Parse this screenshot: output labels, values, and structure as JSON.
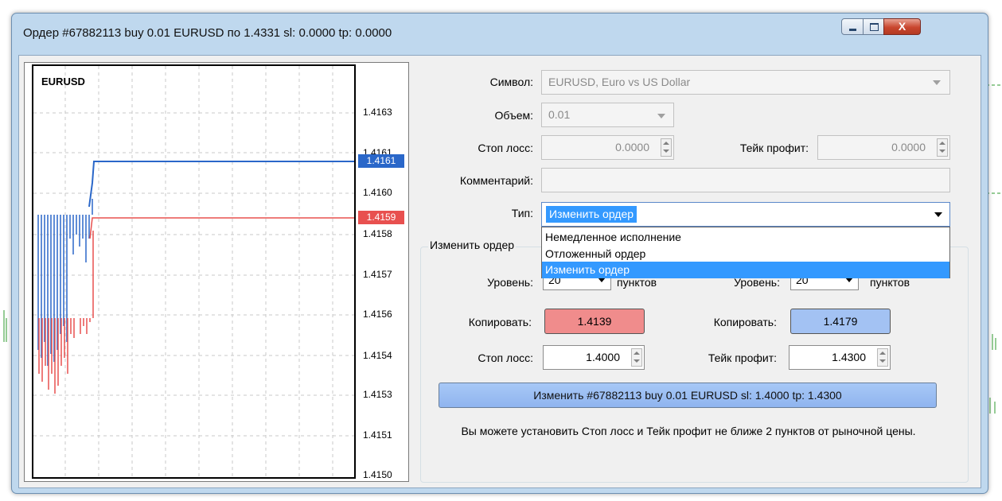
{
  "window": {
    "title": "Ордер #67882113 buy 0.01 EURUSD по 1.4331 sl: 0.0000 tp: 0.0000",
    "close_glyph": "X"
  },
  "chart": {
    "symbol": "EURUSD",
    "y_labels": [
      "1.4163",
      "1.4161",
      "1.4160",
      "1.4158",
      "1.4157",
      "1.4156",
      "1.4154",
      "1.4153",
      "1.4151",
      "1.4150"
    ],
    "ask_tag": "1.4161",
    "bid_tag": "1.4159",
    "ask_color": "#2a67c9",
    "bid_color": "#e8504f"
  },
  "form": {
    "symbol_label": "Символ:",
    "symbol_value": "EURUSD, Euro vs US Dollar",
    "volume_label": "Объем:",
    "volume_value": "0.01",
    "sl_label": "Стоп лосс:",
    "sl_value": "0.0000",
    "tp_label": "Тейк профит:",
    "tp_value": "0.0000",
    "comment_label": "Комментарий:",
    "comment_value": "",
    "type_label": "Тип:",
    "type_value": "Изменить ордер",
    "type_options": [
      "Немедленное исполнение",
      "Отложенный ордер",
      "Изменить ордер"
    ]
  },
  "modify": {
    "group_title": "Изменить ордер",
    "level_label": "Уровень:",
    "level_left_value": "20",
    "level_right_value": "20",
    "points_label": "пунктов",
    "copy_label": "Копировать:",
    "copy_left_value": "1.4139",
    "copy_right_value": "1.4179",
    "copy_left_color": "#f08c8c",
    "copy_right_color": "#a3c2f3",
    "sl_label": "Стоп лосс:",
    "sl_value": "1.4000",
    "tp_label": "Тейк профит:",
    "tp_value": "1.4300",
    "submit_label": "Изменить #67882113 buy 0.01 EURUSD sl: 1.4000 tp: 1.4300",
    "note": "Вы можете установить Стоп лосс и Тейк профит не ближе 2 пунктов от рыночной цены."
  }
}
